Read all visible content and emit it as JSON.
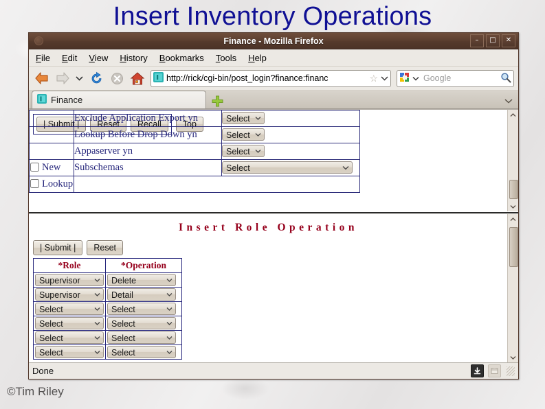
{
  "slide": {
    "title": "Insert Inventory Operations",
    "copyright": "©Tim Riley",
    "title_color": "#101094"
  },
  "browser": {
    "window_title": "Finance - Mozilla Firefox",
    "window_buttons": {
      "minimize": "–",
      "maximize": "□",
      "close": "✕"
    },
    "menu": [
      {
        "pre": "",
        "key": "F",
        "post": "ile"
      },
      {
        "pre": "",
        "key": "E",
        "post": "dit"
      },
      {
        "pre": "",
        "key": "V",
        "post": "iew"
      },
      {
        "pre": "",
        "key": "H",
        "post": "istory"
      },
      {
        "pre": "",
        "key": "B",
        "post": "ookmarks"
      },
      {
        "pre": "",
        "key": "T",
        "post": "ools"
      },
      {
        "pre": "",
        "key": "H",
        "post": "elp"
      }
    ],
    "nav": {
      "back_icon": "back-arrow-icon",
      "forward_icon": "forward-arrow-icon",
      "history_chevron": "⌄",
      "reload_icon": "reload-icon",
      "stop_icon": "stop-icon",
      "home_icon": "home-icon"
    },
    "url": "http://rick/cgi-bin/post_login?finance:financ",
    "url_star": "☆",
    "url_chevron": "⌄",
    "search_placeholder": "Google",
    "search_engine_chevron": "⌄",
    "tab": {
      "label": "Finance",
      "favicon": "site-favicon"
    },
    "newtab_label": "+",
    "tablist_chevron": "⌄",
    "status": {
      "text": "Done",
      "download_icon": "⬇",
      "panel_icon": "▦"
    }
  },
  "top_form": {
    "rows": [
      {
        "checkbox": null,
        "label": "Exclude Application Export yn",
        "field": "Select",
        "field_width": "small"
      },
      {
        "checkbox": null,
        "label": "Lookup Before Drop Down yn",
        "field": "Select",
        "field_width": "small"
      },
      {
        "checkbox": null,
        "label": "Appaserver yn",
        "field": "Select",
        "field_width": "small"
      },
      {
        "checkbox": "New",
        "label": "Subschemas",
        "field": "Select",
        "field_width": "wide"
      },
      {
        "checkbox": "Lookup",
        "label": "",
        "field": null,
        "field_width": null
      }
    ],
    "buttons": [
      "|  Submit  |",
      "Reset",
      "Recall",
      "Top"
    ]
  },
  "bottom_form": {
    "title": "Insert Role Operation",
    "buttons": [
      "|  Submit  |",
      "Reset"
    ],
    "columns": [
      "*Role",
      "*Operation"
    ],
    "rows": [
      {
        "role": "Supervisor",
        "operation": "Delete"
      },
      {
        "role": "Supervisor",
        "operation": "Detail"
      },
      {
        "role": "Select",
        "operation": "Select"
      },
      {
        "role": "Select",
        "operation": "Select"
      },
      {
        "role": "Select",
        "operation": "Select"
      },
      {
        "role": "Select",
        "operation": "Select"
      }
    ]
  }
}
